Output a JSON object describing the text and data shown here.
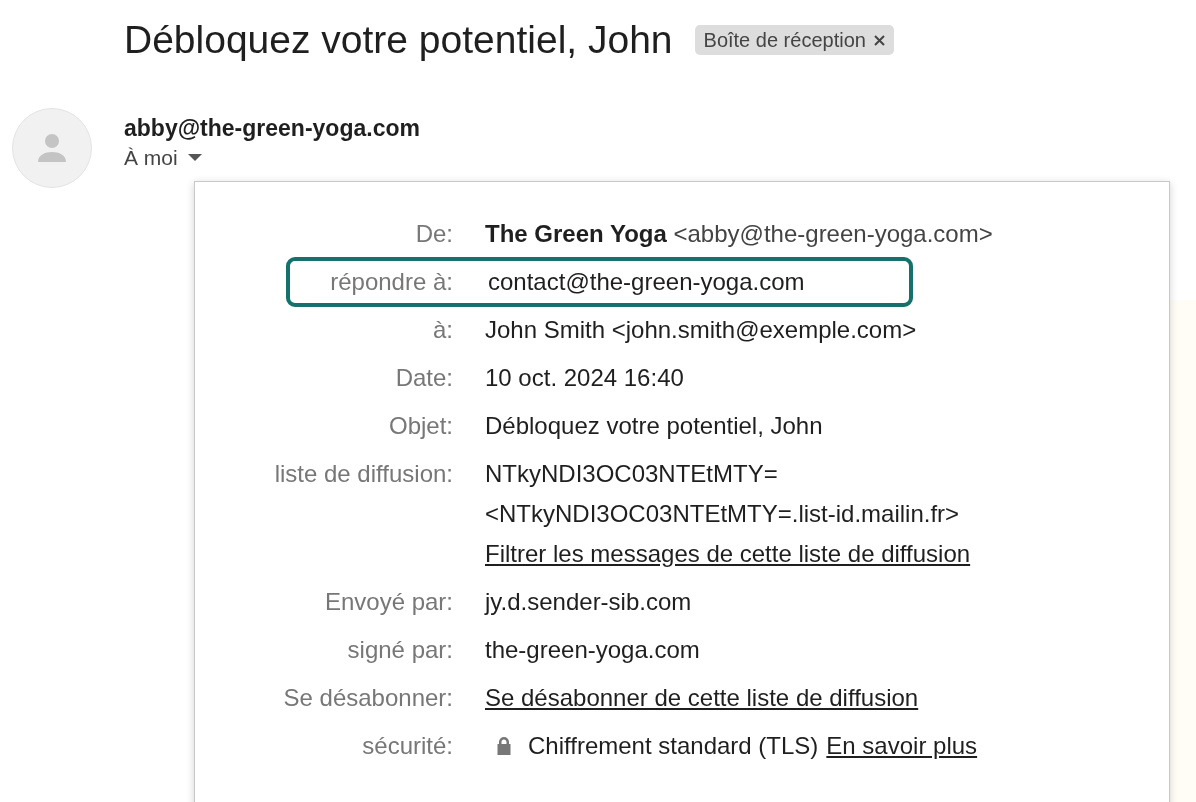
{
  "subject": "Débloquez votre potentiel, John",
  "label_chip": {
    "text": "Boîte de réception"
  },
  "sender": {
    "address": "abby@the-green-yoga.com",
    "recipient_toggle": "À moi",
    "expanded": true
  },
  "details": [
    {
      "label": "De:",
      "kind": "sender",
      "name": "The Green Yoga",
      "value": "<abby@the-green-yoga.com>",
      "highlighted": false
    },
    {
      "label": "répondre à:",
      "kind": "text",
      "value": "contact@the-green-yoga.com",
      "highlighted": true
    },
    {
      "label": "à:",
      "kind": "text",
      "value": "John Smith <john.smith@exemple.com>",
      "highlighted": false
    },
    {
      "label": "Date:",
      "kind": "text",
      "value": "10 oct. 2024 16:40",
      "highlighted": false
    },
    {
      "label": "Objet:",
      "kind": "text",
      "value": "Débloquez votre potentiel, John",
      "highlighted": false
    },
    {
      "label": "liste de diffusion:",
      "kind": "list",
      "value": "NTkyNDI3OC03NTEtMTY= <NTkyNDI3OC03NTEtMTY=.list-id.mailin.fr>",
      "link": "Filtrer les messages de cette liste de diffusion",
      "highlighted": false
    },
    {
      "label": "Envoyé par:",
      "kind": "text",
      "value": "jy.d.sender-sib.com",
      "highlighted": false
    },
    {
      "label": "signé par:",
      "kind": "text",
      "value": "the-green-yoga.com",
      "highlighted": false
    },
    {
      "label": "Se désabonner:",
      "kind": "link",
      "link": "Se désabonner de cette liste de diffusion",
      "highlighted": false
    },
    {
      "label": "sécurité:",
      "kind": "security",
      "value": "Chiffrement standard (TLS)",
      "link": "En savoir plus",
      "highlighted": false
    }
  ]
}
